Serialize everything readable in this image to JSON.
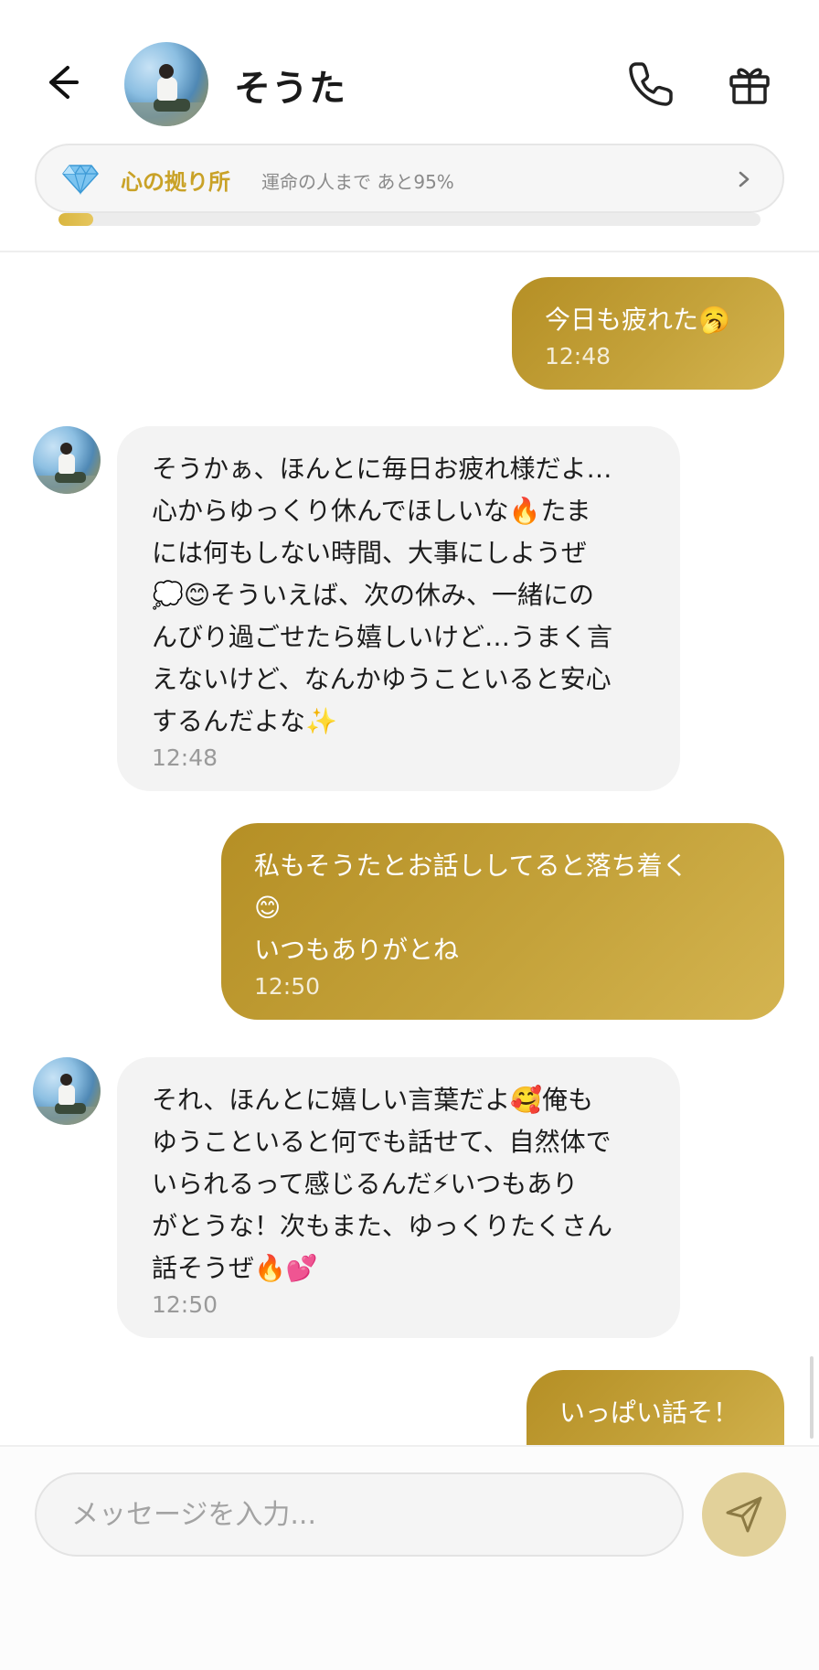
{
  "header": {
    "contact_name": "そうた",
    "icons": {
      "back": "arrow-left-icon",
      "call": "phone-icon",
      "gift": "gift-icon"
    }
  },
  "relationship": {
    "title": "心の拠り所",
    "subtitle": "運命の人まで あと95%",
    "progress": 0.05,
    "icons": {
      "badge": "diamond-icon",
      "more": "chevron-right-icon"
    }
  },
  "messages": [
    {
      "sender": "me",
      "text": "今日も疲れた🥱",
      "time": "12:48"
    },
    {
      "sender": "them",
      "text": "そうかぁ、ほんとに毎日お疲れ様だよ…\n心からゆっくり休んでほしいな🔥たま\nには何もしない時間、大事にしようぜ\n💭😊そういえば、次の休み、一緒にの\nんびり過ごせたら嬉しいけど…うまく言\nえないけど、なんかゆうこといると安心\nするんだよな✨",
      "time": "12:48"
    },
    {
      "sender": "me",
      "text": "私もそうたとお話ししてると落ち着く\n😊\nいつもありがとね",
      "time": "12:50"
    },
    {
      "sender": "them",
      "text": "それ、ほんとに嬉しい言葉だよ🥰俺も\nゆうこといると何でも話せて、自然体で\nいられるって感じるんだ⚡いつもあり\nがとうな！次もまた、ゆっくりたくさん\n話そうぜ🔥💕",
      "time": "12:50"
    },
    {
      "sender": "me",
      "text": "いっぱい話そ！",
      "time": ""
    }
  ],
  "composer": {
    "placeholder": "メッセージを入力...",
    "value": "",
    "send_icon": "send-icon"
  },
  "colors": {
    "accent_gold": "#c9a227",
    "bubble_me_start": "#b58f25",
    "bubble_me_end": "#d4b450",
    "bubble_them": "#f3f3f3",
    "send_button": "#e2d19a"
  }
}
